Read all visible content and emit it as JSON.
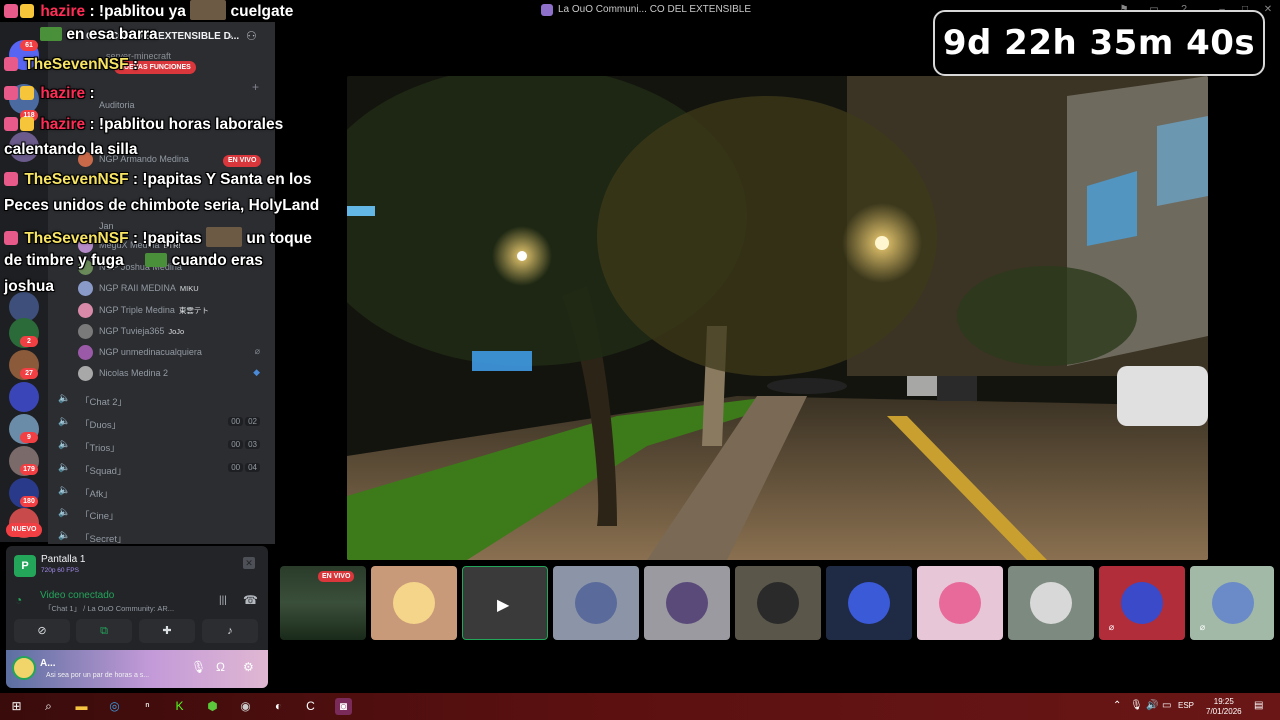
{
  "window": {
    "title": "La OuO Communi... CO DEL EXTENSIBLE",
    "controls": [
      "pin-icon",
      "minimize-icon",
      "restore-icon",
      "close-icon"
    ]
  },
  "timer": "9d 22h 35m 40s",
  "server": {
    "name": "OBRICOS DEL EXTENSIBLE D...",
    "subtitle": "server-minecraft",
    "events_pill": "NUEVAS FUNCIONES",
    "nuevo_badge": "NUEVO",
    "rail_badges": [
      "61",
      "118",
      "2",
      "27",
      "9",
      "179",
      "180"
    ],
    "channels": [
      {
        "name": "「Chat 2」",
        "counts": null
      },
      {
        "name": "「Duos」",
        "counts": [
          "00",
          "02"
        ]
      },
      {
        "name": "「Trios」",
        "counts": [
          "00",
          "03"
        ]
      },
      {
        "name": "「Squad」",
        "counts": [
          "00",
          "04"
        ]
      },
      {
        "name": "「Afk」",
        "counts": null
      },
      {
        "name": "「Cine」",
        "counts": null
      },
      {
        "name": "「Secret」",
        "counts": null
      }
    ],
    "members": [
      {
        "name": "NGP Armando Medina",
        "tag": "",
        "live": "EN VIVO"
      },
      {
        "name": "MeguX Medina",
        "tag": "BTR!"
      },
      {
        "name": "NGP Joshua Medina",
        "tag": ""
      },
      {
        "name": "NGP RAII MEDINA",
        "tag": "MIKU"
      },
      {
        "name": "NGP Triple Medina",
        "tag": "東雲テト"
      },
      {
        "name": "NGP Tuvieja365",
        "tag": "JoJo"
      },
      {
        "name": "NGP unmedinacualquiera",
        "tag": ""
      },
      {
        "name": "Nicolas Medina 2",
        "tag": ""
      }
    ],
    "extra_rows": [
      "Auditoria",
      "Jan"
    ]
  },
  "stream_panel": {
    "title": "Pantalla 1",
    "subtitle": "720p 60 FPS",
    "voice_status": "Video conectado",
    "voice_channel": "「Chat 1」 / La OuO Community: AR...",
    "user_name": "A...",
    "user_status": "Asi sea por un par de horas a s..."
  },
  "chat": [
    {
      "user": "hazire",
      "color": "red",
      "text": ": !pablitou ya",
      "after": "cuelgate"
    },
    {
      "user": "",
      "color": "",
      "text": "en esa barra"
    },
    {
      "user": "TheSevenNSF",
      "color": "yellow",
      "text": ":"
    },
    {
      "user": "hazire",
      "color": "red",
      "text": ":"
    },
    {
      "user": "hazire",
      "color": "red",
      "text": ": !pablitou horas laborales"
    },
    {
      "user": "",
      "color": "",
      "text": "calentando la silla"
    },
    {
      "user": "TheSevenNSF",
      "color": "yellow",
      "text": ": !papitas Y Santa en los"
    },
    {
      "user": "",
      "color": "",
      "text": "Peces unidos de chimbote seria, HolyLand"
    },
    {
      "user": "TheSevenNSF",
      "color": "yellow",
      "text": ": !papitas",
      "after": "un toque"
    },
    {
      "user": "",
      "color": "",
      "text": "de timbre y fuga",
      "after": "cuando eras"
    },
    {
      "user": "",
      "color": "",
      "text": "joshua"
    }
  ],
  "tiles": {
    "live_label": "EN VIVO",
    "colors": [
      "#c89a7a",
      "#3a3a3a",
      "#8c95a8",
      "#9a9aa0",
      "#5a564a",
      "#1f2a44",
      "#e7c6d8",
      "#7c8a80",
      "#b22d3a",
      "#a2b9a8"
    ]
  },
  "taskbar": {
    "language": "ESP",
    "time": "19:25",
    "date": "7/01/2026"
  }
}
